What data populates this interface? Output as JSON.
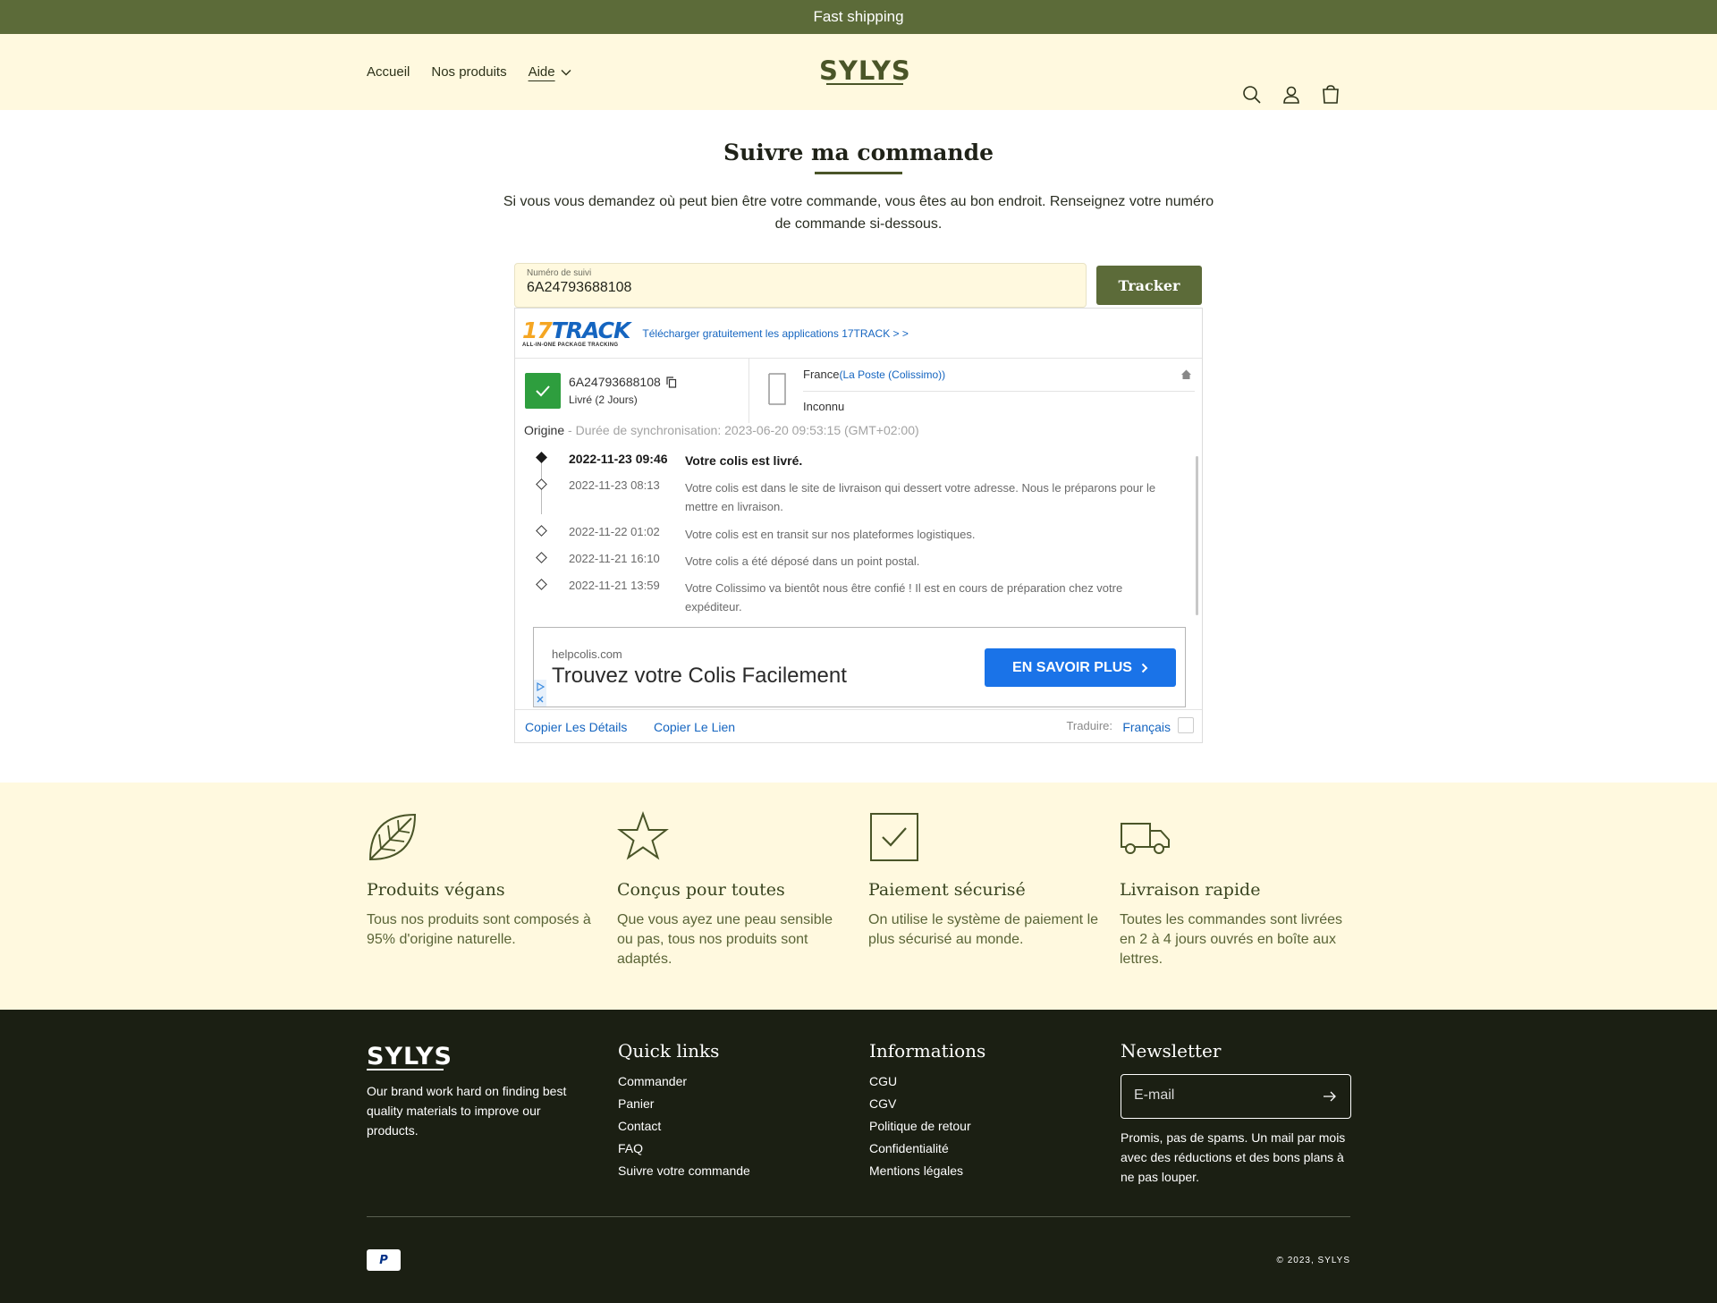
{
  "announcement": "Fast shipping",
  "nav": {
    "home": "Accueil",
    "products": "Nos produits",
    "help": "Aide"
  },
  "logo": "SYLYS",
  "page": {
    "title": "Suivre ma commande",
    "intro": "Si vous vous demandez où peut bien être votre commande, vous êtes au bon endroit. Renseignez votre numéro de commande si-dessous.",
    "input_label": "Numéro de suivi",
    "input_value": "6A24793688108",
    "tracker_button": "Tracker"
  },
  "widget": {
    "brand_main_a": "17",
    "brand_main_b": "TRACK",
    "brand_sub": "ALL-IN-ONE PACKAGE TRACKING",
    "download_link": "Télécharger gratuitement les applications 17TRACK > >",
    "tracking_number": "6A24793688108",
    "status": "Livré (2 Jours)",
    "country": "France",
    "carrier": "(La Poste (Colissimo))",
    "unknown": "Inconnu",
    "origin_label": "Origine",
    "sync": " - Durée de synchronisation: 2023-06-20 09:53:15 (GMT+02:00)",
    "events": [
      {
        "time": "2022-11-23 09:46",
        "desc": "Votre colis est livré."
      },
      {
        "time": "2022-11-23 08:13",
        "desc": "Votre colis est dans le site de livraison qui dessert votre adresse. Nous le préparons pour le mettre en livraison."
      },
      {
        "time": "2022-11-22 01:02",
        "desc": "Votre colis est en transit sur nos plateformes logistiques."
      },
      {
        "time": "2022-11-21 16:10",
        "desc": "Votre colis a été déposé dans un point postal."
      },
      {
        "time": "2022-11-21 13:59",
        "desc": "Votre Colissimo va bientôt nous être confié ! Il est en cours de préparation chez votre expéditeur."
      }
    ],
    "ad_domain": "helpcolis.com",
    "ad_title": "Trouvez votre Colis Facilement",
    "ad_button": "EN SAVOIR PLUS",
    "copy_details": "Copier Les Détails",
    "copy_link": "Copier Le Lien",
    "translate_label": "Traduire:",
    "language": "Français"
  },
  "features": [
    {
      "icon": "leaf-icon",
      "title": "Produits végans",
      "text": "Tous nos produits sont composés à 95% d'origine naturelle."
    },
    {
      "icon": "star-icon",
      "title": "Conçus pour toutes",
      "text": "Que vous ayez une peau sensible ou pas, tous nos produits sont adaptés."
    },
    {
      "icon": "checkbox-icon",
      "title": "Paiement sécurisé",
      "text": "On utilise le système de paiement le plus sécurisé au monde."
    },
    {
      "icon": "truck-icon",
      "title": "Livraison rapide",
      "text": "Toutes les commandes sont livrées en 2 à 4 jours ouvrés en boîte aux lettres."
    }
  ],
  "footer": {
    "logo": "SYLYS",
    "about": "Our brand work hard on finding best quality materials to improve our products.",
    "quick_links_title": "Quick links",
    "quick_links": [
      "Commander",
      "Panier",
      "Contact",
      "FAQ",
      "Suivre votre commande"
    ],
    "info_title": "Informations",
    "info_links": [
      "CGU",
      "CGV",
      "Politique de retour",
      "Confidentialité",
      "Mentions légales"
    ],
    "newsletter_title": "Newsletter",
    "email_placeholder": "E-mail",
    "newsletter_text": "Promis, pas de spams. Un mail par mois avec des réductions et des bons plans à ne pas louper.",
    "payment": "P",
    "copyright": "© 2023, SYLYS"
  }
}
